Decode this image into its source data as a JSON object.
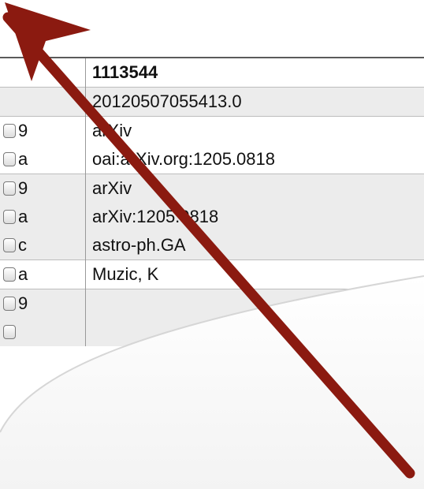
{
  "record": {
    "rows": [
      {
        "cells": [
          {
            "cls": "c-sub",
            "checkbox": false,
            "code": ""
          },
          {
            "cls": "c-val",
            "text": "1113544"
          }
        ],
        "klass": "top-rule row-id"
      },
      {
        "cells": [
          {
            "cls": "c-sub",
            "checkbox": false,
            "code": ""
          },
          {
            "cls": "c-val",
            "text": "20120507055413.0"
          }
        ],
        "klass": "shade group-start"
      },
      {
        "cells": [
          {
            "cls": "c-sub",
            "checkbox": true,
            "code": "9"
          },
          {
            "cls": "c-val",
            "text": "arXiv"
          }
        ],
        "klass": "group-start"
      },
      {
        "cells": [
          {
            "cls": "c-sub",
            "checkbox": true,
            "code": "a"
          },
          {
            "cls": "c-val",
            "text": "oai:arXiv.org:1205.0818"
          }
        ],
        "klass": ""
      },
      {
        "cells": [
          {
            "cls": "c-sub",
            "checkbox": true,
            "code": "9"
          },
          {
            "cls": "c-val",
            "text": "arXiv"
          }
        ],
        "klass": "shade group-start"
      },
      {
        "cells": [
          {
            "cls": "c-sub",
            "checkbox": true,
            "code": "a"
          },
          {
            "cls": "c-val",
            "text": "arXiv:1205.0818"
          }
        ],
        "klass": "shade"
      },
      {
        "cells": [
          {
            "cls": "c-sub",
            "checkbox": true,
            "code": "c"
          },
          {
            "cls": "c-val",
            "text": "astro-ph.GA"
          }
        ],
        "klass": "shade"
      },
      {
        "cells": [
          {
            "cls": "c-sub",
            "checkbox": true,
            "code": "a"
          },
          {
            "cls": "c-val",
            "text": "Muzic, K"
          }
        ],
        "klass": "group-start"
      },
      {
        "cells": [
          {
            "cls": "c-sub",
            "checkbox": true,
            "code": "9"
          },
          {
            "cls": "c-val",
            "text": ""
          }
        ],
        "klass": "shade group-start"
      },
      {
        "cells": [
          {
            "cls": "c-sub",
            "checkbox": true,
            "code": ""
          },
          {
            "cls": "c-val",
            "text": ""
          }
        ],
        "klass": "shade"
      }
    ]
  },
  "colors": {
    "arrow": "#8b1a10",
    "page_curl": "#f5f5f5"
  }
}
